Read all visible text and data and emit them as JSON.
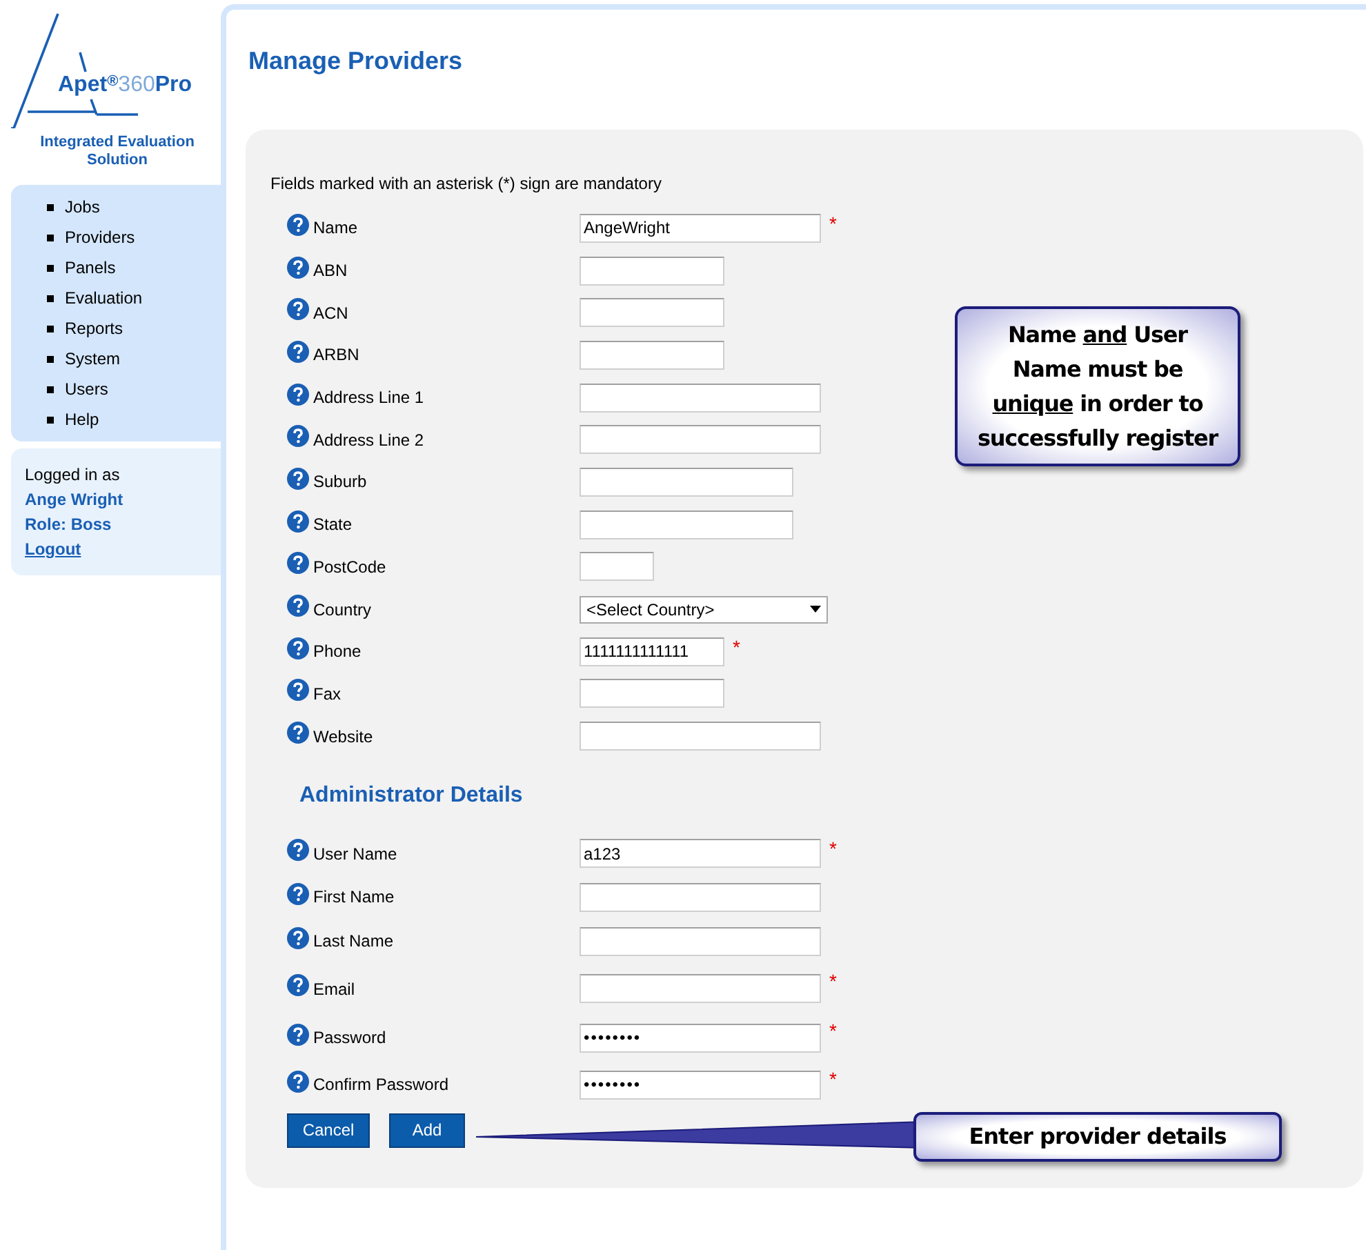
{
  "logo": {
    "brand": "Apet",
    "reg": "®",
    "number": "360",
    "suffix": "Pro",
    "tagline": "Integrated Evaluation Solution"
  },
  "nav": {
    "items": [
      {
        "label": "Jobs"
      },
      {
        "label": "Providers"
      },
      {
        "label": "Panels"
      },
      {
        "label": "Evaluation"
      },
      {
        "label": "Reports"
      },
      {
        "label": "System"
      },
      {
        "label": "Users"
      },
      {
        "label": "Help"
      }
    ]
  },
  "user_panel": {
    "intro": "Logged in as",
    "name": "Ange Wright",
    "role": "Role: Boss",
    "logout": "Logout"
  },
  "page_title": "Manage Providers",
  "mandatory_note": "Fields marked with an asterisk (*) sign are mandatory",
  "provider_fields": [
    {
      "label": "Name",
      "kind": "long",
      "value": "AngeWright",
      "marker": "*"
    },
    {
      "label": "ABN",
      "kind": "medium"
    },
    {
      "label": "ACN",
      "kind": "medium"
    },
    {
      "label": "ARBN",
      "kind": "medium"
    },
    {
      "label": "Address Line 1",
      "kind": "long"
    },
    {
      "label": "Address Line 2",
      "kind": "long"
    },
    {
      "label": "Suburb",
      "kind": "wide"
    },
    {
      "label": "State",
      "kind": "wide"
    },
    {
      "label": "PostCode",
      "kind": "short"
    },
    {
      "label": "Country",
      "kind": "select",
      "value": "<Select Country>"
    },
    {
      "label": "Phone",
      "kind": "medium",
      "value": "1111111111111",
      "marker": "*"
    },
    {
      "label": "Fax",
      "kind": "medium"
    },
    {
      "label": "Website",
      "kind": "long"
    }
  ],
  "admin_heading": "Administrator Details",
  "admin_fields": [
    {
      "label": "User Name",
      "kind": "long",
      "value": "a123",
      "marker": "*"
    },
    {
      "label": "First Name",
      "kind": "long"
    },
    {
      "label": "Last Name",
      "kind": "long"
    },
    {
      "label": "Email",
      "kind": "long",
      "marker": "*"
    },
    {
      "label": "Password",
      "kind": "password",
      "value": "••••••••",
      "marker": "*"
    },
    {
      "label": "Confirm Password",
      "kind": "password",
      "value": "••••••••",
      "marker": "*"
    }
  ],
  "buttons": [
    "Cancel",
    "Add"
  ],
  "callouts": [
    {
      "segments": [
        {
          "text": "Name ",
          "underline": false
        },
        {
          "text": "and",
          "underline": true
        },
        {
          "text": " User Name must be ",
          "underline": false
        },
        {
          "text": "unique",
          "underline": true
        },
        {
          "text": " in order to successfully register",
          "underline": false
        }
      ]
    },
    {
      "segments": [
        {
          "text": "Enter provider details",
          "underline": false
        }
      ]
    }
  ]
}
